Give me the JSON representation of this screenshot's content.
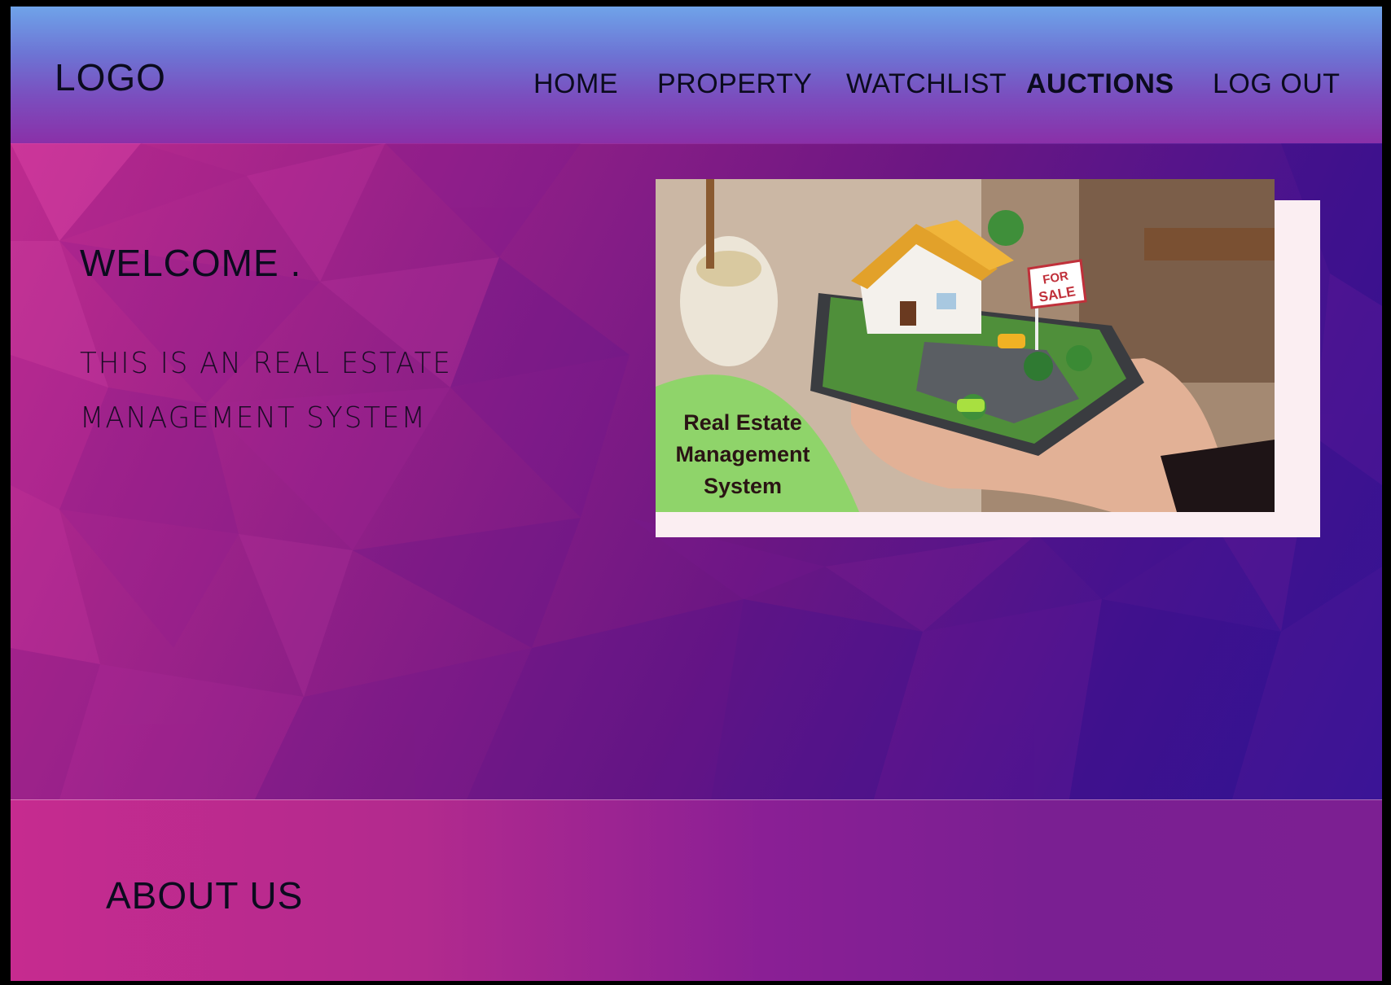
{
  "header": {
    "logo": "LOGO",
    "nav": [
      {
        "label": "HOME",
        "active": false
      },
      {
        "label": "PROPERTY",
        "active": false
      },
      {
        "label": "WATCHLIST",
        "active": false
      },
      {
        "label": "AUCTIONS",
        "active": true
      },
      {
        "label": "LOG OUT",
        "active": false
      }
    ]
  },
  "hero": {
    "welcome": "WELCOME .",
    "subtitle": "THIS IS AN REAL ESTATE MANAGEMENT SYSTEM",
    "image": {
      "badge_lines": [
        "Real Estate",
        "Management",
        "System"
      ],
      "sign_text": [
        "FOR",
        "SALE"
      ]
    }
  },
  "about": {
    "title": "ABOUT US"
  },
  "colors": {
    "header_top": "#6fa3e9",
    "header_bottom": "#8a30a8",
    "hero_pink": "#c82d96",
    "hero_indigo": "#32148f",
    "badge_green": "#8fd46a",
    "card_bg": "#fbeef2"
  }
}
